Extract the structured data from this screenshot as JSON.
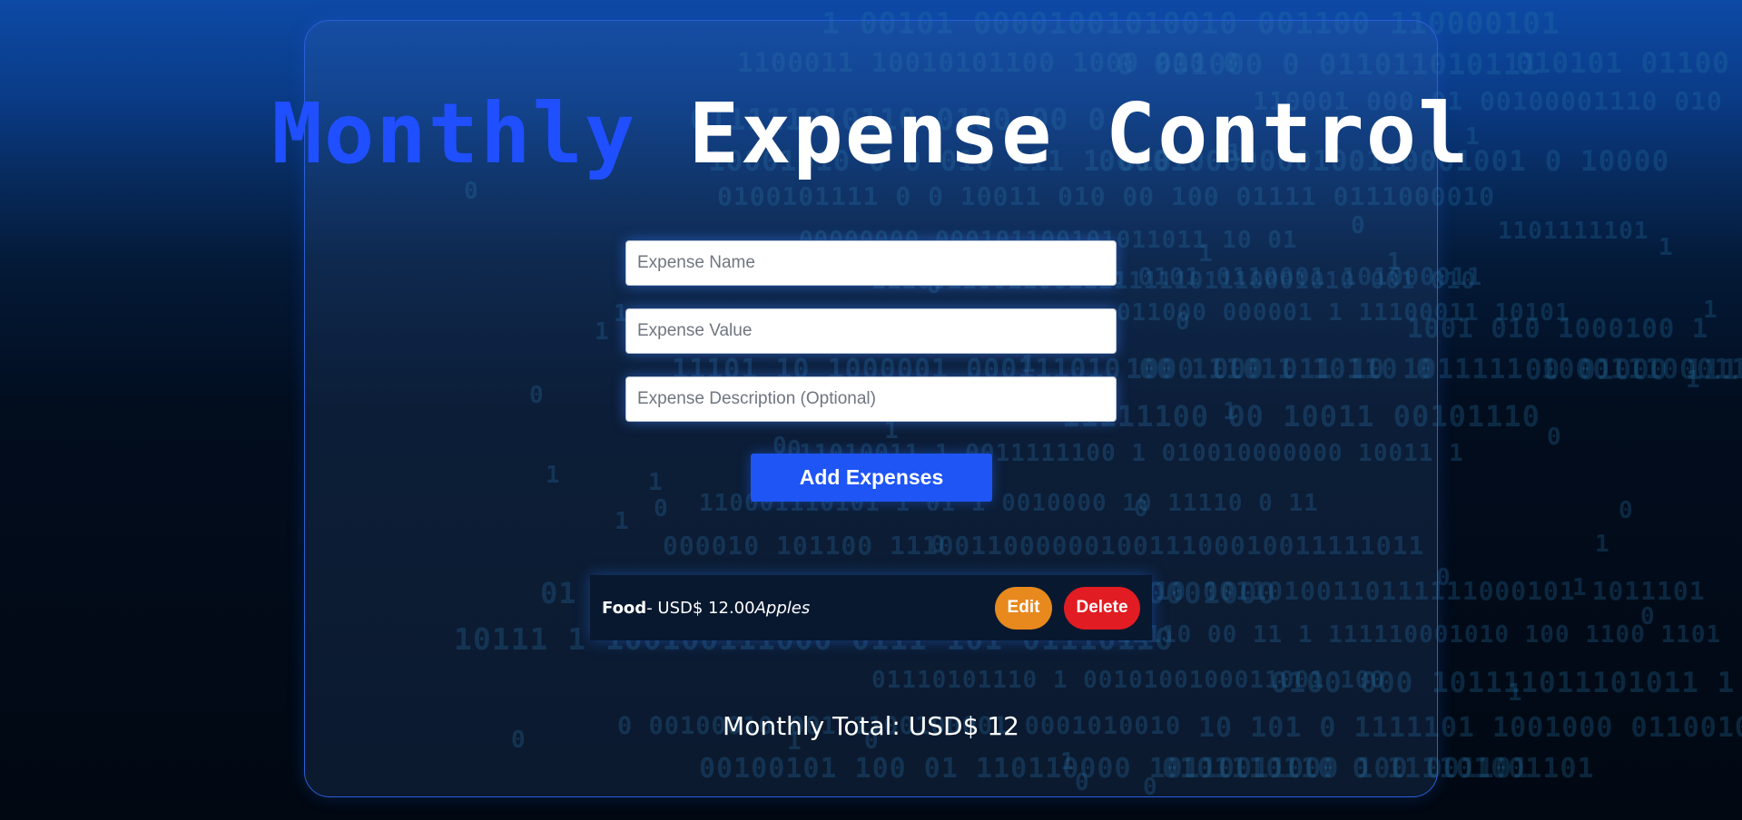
{
  "header": {
    "title_word1": "Monthly",
    "title_word2": "Expense Control"
  },
  "form": {
    "name_placeholder": "Expense Name",
    "value_placeholder": "Expense Value",
    "description_placeholder": "Expense Description (Optional)",
    "add_button_label": "Add Expenses"
  },
  "expenses": [
    {
      "name": "Food",
      "separator": "- ",
      "amount": "USD$ 12.00",
      "description": "Apples",
      "edit_label": "Edit",
      "delete_label": "Delete"
    }
  ],
  "total": {
    "text": "Monthly Total: USD$ 12"
  },
  "colors": {
    "accent_blue": "#1f4fff",
    "button_blue": "#1f55f5",
    "edit_orange": "#e8891e",
    "delete_red": "#e11c22"
  }
}
